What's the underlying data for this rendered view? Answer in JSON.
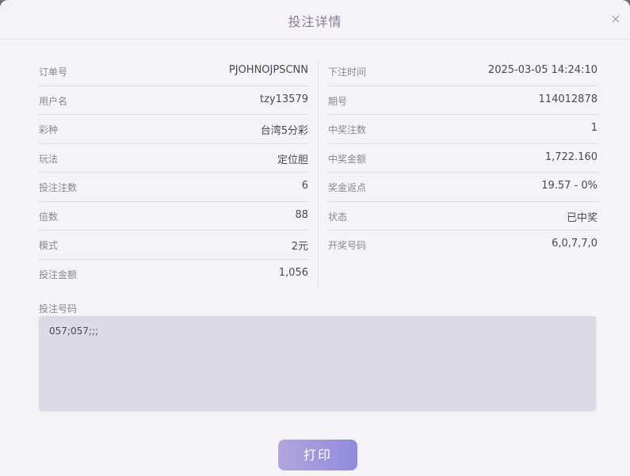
{
  "dialog": {
    "title": "投注详情",
    "close_icon": "close-icon",
    "close_glyph": "×"
  },
  "details": {
    "left": [
      {
        "label": "订单号",
        "value": "PJOHNOJPSCNN"
      },
      {
        "label": "用户名",
        "value": "tzy13579"
      },
      {
        "label": "彩种",
        "value": "台湾5分彩"
      },
      {
        "label": "玩法",
        "value": "定位胆"
      },
      {
        "label": "投注注数",
        "value": "6"
      },
      {
        "label": "倍数",
        "value": "88"
      },
      {
        "label": "模式",
        "value": "2元"
      },
      {
        "label": "投注金额",
        "value": "1,056"
      }
    ],
    "right": [
      {
        "label": "下注时间",
        "value": "2025-03-05 14:24:10"
      },
      {
        "label": "期号",
        "value": "114012878"
      },
      {
        "label": "中奖注数",
        "value": "1"
      },
      {
        "label": "中奖金额",
        "value": "1,722.160"
      },
      {
        "label": "奖金返点",
        "value": "19.57 - 0%"
      },
      {
        "label": "状态",
        "value": "已中奖"
      },
      {
        "label": "开奖号码",
        "value": "6,0,7,7,0"
      }
    ]
  },
  "bet_numbers": {
    "label": "投注号码",
    "value": "057;057;;;"
  },
  "actions": {
    "print_label": "打印"
  },
  "colors": {
    "accent_gradient_start": "#b3a4de",
    "accent_gradient_end": "#8f8bdb",
    "title_color": "#8a7a9a"
  }
}
